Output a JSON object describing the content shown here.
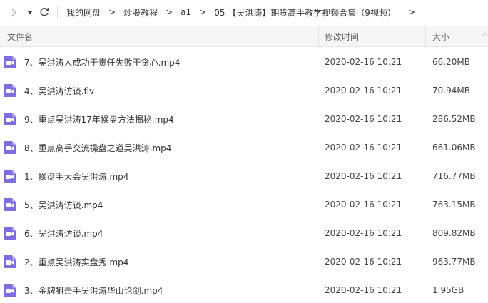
{
  "breadcrumb": {
    "items": [
      "我的网盘",
      "炒股教程",
      "a1",
      "05 【吴洪涛】期货高手教学视频合集（9视频）"
    ],
    "separator": ">",
    "trailing": ">"
  },
  "columns": {
    "name": "文件名",
    "modified": "修改时间",
    "size": "大小"
  },
  "colors": {
    "video_icon": "#7b6fe0",
    "header_bg": "#f6f6f6"
  },
  "files": [
    {
      "name": "7、吴洪涛人成功于责任失败于贪心.mp4",
      "modified": "2020-02-16 10:21",
      "size": "66.20MB"
    },
    {
      "name": "4、吴洪涛访谈.flv",
      "modified": "2020-02-16 10:21",
      "size": "70.94MB"
    },
    {
      "name": "9、重点吴洪涛17年操盘方法揭秘.mp4",
      "modified": "2020-02-16 10:21",
      "size": "286.52MB"
    },
    {
      "name": "8、重点高手交流操盘之道吴洪涛.mp4",
      "modified": "2020-02-16 10:21",
      "size": "661.06MB"
    },
    {
      "name": "1、操盘手大会吴洪涛.mp4",
      "modified": "2020-02-16 10:21",
      "size": "716.77MB"
    },
    {
      "name": "5、吴洪涛访谈.mp4",
      "modified": "2020-02-16 10:21",
      "size": "763.15MB"
    },
    {
      "name": "6、吴洪涛访谈.mp4",
      "modified": "2020-02-16 10:21",
      "size": "809.82MB"
    },
    {
      "name": "2、重点吴洪涛实盘秀.mp4",
      "modified": "2020-02-16 10:21",
      "size": "963.77MB"
    },
    {
      "name": "3、金牌狙击手吴洪涛华山论剑.mp4",
      "modified": "2020-02-16 10:21",
      "size": "1.95GB"
    }
  ]
}
